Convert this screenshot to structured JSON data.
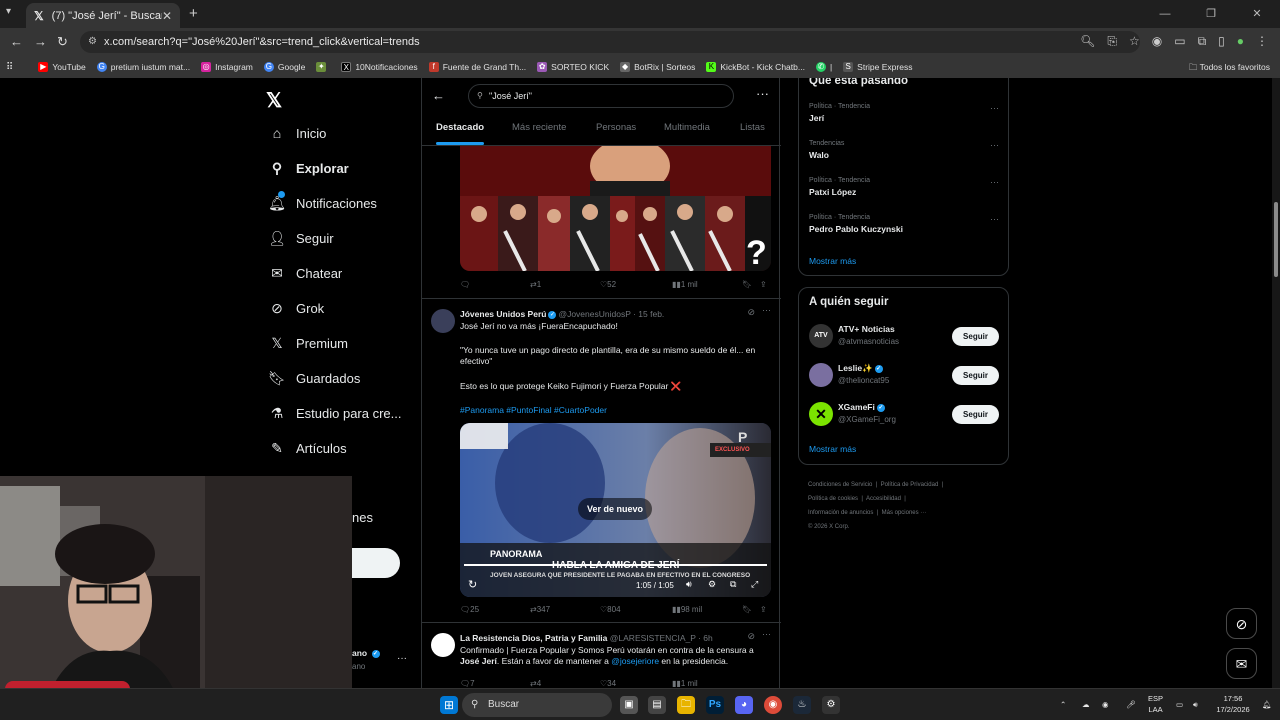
{
  "browser": {
    "tab_title": "(7) \"José Jerí\" - Buscar / X",
    "url": "x.com/search?q=\"José%20Jerí\"&src=trend_click&vertical=trends",
    "bookmarks": [
      {
        "label": "YouTube",
        "icon": "youtube-icon",
        "color": "#ff0000"
      },
      {
        "label": "pretium iustum mat...",
        "icon": "google-icon",
        "color": "#4285f4"
      },
      {
        "label": "Instagram",
        "icon": "instagram-icon",
        "color": "#d6249f"
      },
      {
        "label": "Google",
        "icon": "google-icon",
        "color": "#4285f4"
      },
      {
        "label": "",
        "icon": "app-icon",
        "color": "#6a8e3a"
      },
      {
        "label": "10Notificaciones",
        "icon": "x-icon",
        "color": "#000000"
      },
      {
        "label": "Fuente de Grand Th...",
        "icon": "font-icon",
        "color": "#c0392b"
      },
      {
        "label": "SORTEO KICK",
        "icon": "bookmark-icon",
        "color": "#9b59b6"
      },
      {
        "label": "BotRix | Sorteos",
        "icon": "bookmark-icon",
        "color": "#666666"
      },
      {
        "label": "KickBot - Kick Chatb...",
        "icon": "kick-icon",
        "color": "#53fc18"
      },
      {
        "label": "|",
        "icon": "whatsapp-icon",
        "color": "#25d366"
      },
      {
        "label": "Stripe Express",
        "icon": "bookmark-icon",
        "color": "#555555"
      }
    ],
    "all_bookmarks": "Todos los favoritos"
  },
  "sidebar": {
    "items": [
      {
        "label": "Inicio",
        "icon": "home-icon"
      },
      {
        "label": "Explorar",
        "icon": "search-icon"
      },
      {
        "label": "Notificaciones",
        "icon": "bell-icon"
      },
      {
        "label": "Seguir",
        "icon": "follow-icon"
      },
      {
        "label": "Chatear",
        "icon": "mail-icon"
      },
      {
        "label": "Grok",
        "icon": "grok-icon"
      },
      {
        "label": "Premium",
        "icon": "x-icon"
      },
      {
        "label": "Guardados",
        "icon": "bookmark-icon"
      },
      {
        "label": "Estudio para cre...",
        "icon": "flask-icon"
      },
      {
        "label": "Artículos",
        "icon": "article-icon"
      }
    ],
    "partial_label": "nes",
    "account_partial": "ano",
    "account_handle_partial": "ano"
  },
  "search": {
    "query": "\"José Jerí\""
  },
  "tabs": [
    "Destacado",
    "Más reciente",
    "Personas",
    "Multimedia",
    "Listas"
  ],
  "tweets": [
    {
      "stats": {
        "replies": "",
        "reposts": "1",
        "likes": "52",
        "views": "1 mil"
      }
    },
    {
      "name": "Jóvenes Unidos Perú",
      "handle": "@JovenesUnidosP",
      "time": "· 15 feb.",
      "line1": "José Jerí no va más ¡FueraEncapuchado!",
      "line2": "\"Yo nunca tuve un pago directo de plantilla, era de su mismo sueldo de él... en efectivo\"",
      "line3": "Esto es lo que protege Keiko Fujimori y Fuerza Popular ❌",
      "hashtags": "#Panorama #PuntoFinal #CuartoPoder",
      "video": {
        "replay": "Ver de nuevo",
        "banner": "HABLA LA AMIGA DE JERÍ",
        "sub": "JOVEN ASEGURA QUE PRESIDENTE LE PAGABA EN EFECTIVO EN EL CONGRESO",
        "time": "1:05 / 1:05",
        "logo": "PANORAMA",
        "tag": "EXCLUSIVO",
        "progress": 1.0
      },
      "stats": {
        "replies": "25",
        "reposts": "347",
        "likes": "804",
        "views": "98 mil"
      }
    },
    {
      "name": "La Resistencia Dios, Patria y Familia",
      "handle": "@LARESISTENCIA_P",
      "time": "· 6h",
      "text_a": "Confirmado | Fuerza Popular y Somos Perú votarán en contra de la censura a ",
      "text_b": "José Jerí",
      "text_c": ". Están a favor de mantener a ",
      "mention": "@josejeriore",
      "text_d": " en la presidencia.",
      "stats": {
        "replies": "7",
        "reposts": "4",
        "likes": "34",
        "views": "1 mil"
      }
    }
  ],
  "trending": {
    "title": "Qué está pasando",
    "items": [
      {
        "meta": "Política · Tendencia",
        "name": "Jerí"
      },
      {
        "meta": "Tendencias",
        "name": "Walo"
      },
      {
        "meta": "Política · Tendencia",
        "name": "Patxi López"
      },
      {
        "meta": "Política · Tendencia",
        "name": "Pedro Pablo Kuczynski"
      }
    ],
    "more": "Mostrar más"
  },
  "who_to_follow": {
    "title": "A quién seguir",
    "items": [
      {
        "name": "ATV+ Noticias",
        "handle": "@atvmasnoticias",
        "button": "Seguir",
        "color": "#333333",
        "avatar_text": "ATV"
      },
      {
        "name": "Leslie✨",
        "handle": "@thelioncat95",
        "button": "Seguir",
        "color": "#7a6fa0",
        "avatar_text": ""
      },
      {
        "name": "XGameFi",
        "handle": "@XGameFi_org",
        "button": "Seguir",
        "color": "#7be300",
        "avatar_text": ""
      }
    ],
    "more": "Mostrar más"
  },
  "footer": {
    "links": [
      "Condiciones de Servicio",
      "Política de Privacidad",
      "Política de cookies",
      "Accesibilidad",
      "Información de anuncios",
      "Más opciones ···"
    ],
    "copyright": "© 2026 X Corp."
  },
  "taskbar": {
    "search": "Buscar",
    "lang": "ESP",
    "lang2": "LAA",
    "time": "17:56",
    "date": "17/2/2026"
  }
}
